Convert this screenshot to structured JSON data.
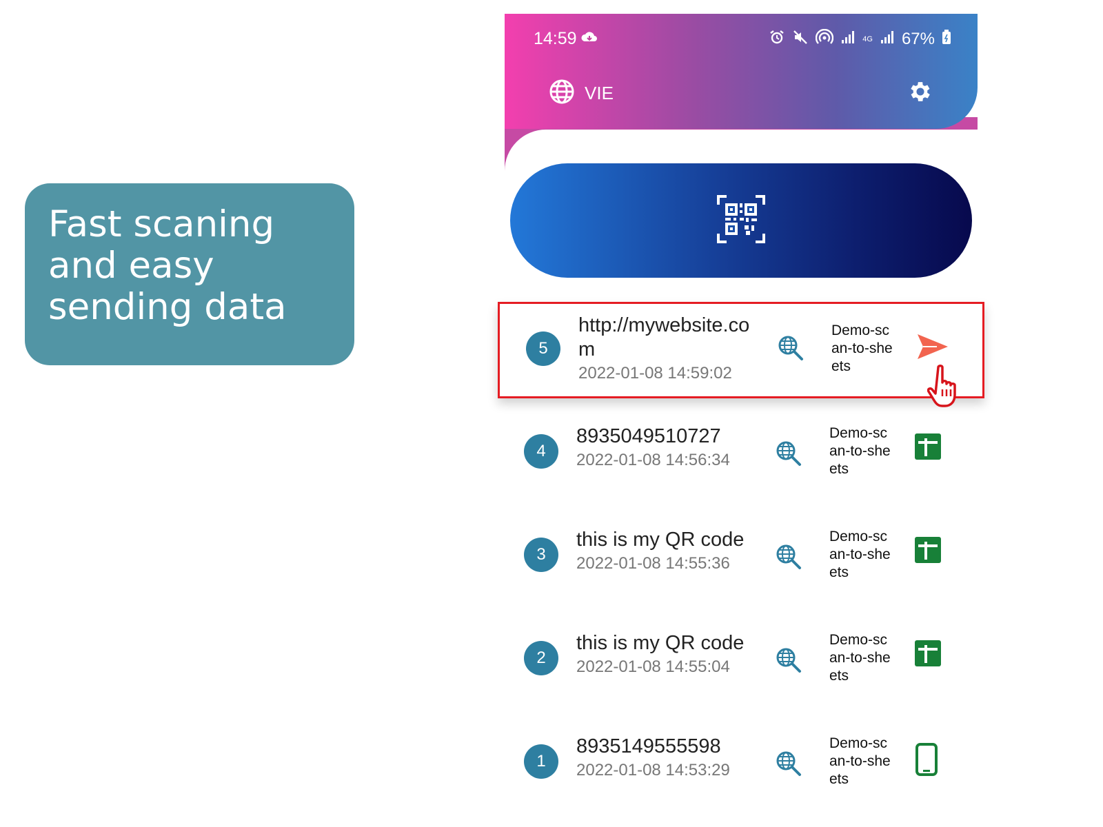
{
  "promo": {
    "text": "Fast scaning and easy sending data"
  },
  "status_bar": {
    "time": "14:59",
    "battery": "67%",
    "network": "4G"
  },
  "header": {
    "language_label": "VIE",
    "icons": [
      "globe-icon",
      "settings-gear-icon"
    ],
    "gradient": [
      "#f33fae",
      "#3a82c7"
    ]
  },
  "scan_button": {
    "icon": "qr-code-icon"
  },
  "scans": [
    {
      "number": "5",
      "content": "http://mywebsite.com",
      "datetime": "2022-01-08 14:59:02",
      "sheet": "Demo-scan-to-sheets",
      "status": "send",
      "highlighted": true
    },
    {
      "number": "4",
      "content": "8935049510727",
      "datetime": "2022-01-08 14:56:34",
      "sheet": "Demo-scan-to-sheets",
      "status": "sheets"
    },
    {
      "number": "3",
      "content": "this is my QR code",
      "datetime": "2022-01-08 14:55:36",
      "sheet": "Demo-scan-to-sheets",
      "status": "sheets"
    },
    {
      "number": "2",
      "content": "this is my QR code",
      "datetime": "2022-01-08 14:55:04",
      "sheet": "Demo-scan-to-sheets",
      "status": "sheets"
    },
    {
      "number": "1",
      "content": "8935149555598",
      "datetime": "2022-01-08 14:53:29",
      "sheet": "Demo-scan-to-sheets",
      "status": "device"
    }
  ],
  "colors": {
    "badge": "#2e7fa1",
    "send": "#f2644f",
    "sheets": "#188038",
    "highlight_border": "#e51c23"
  }
}
